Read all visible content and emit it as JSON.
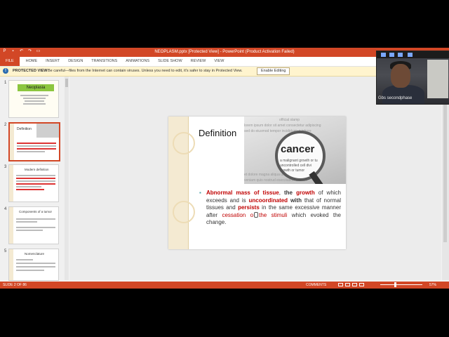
{
  "window": {
    "title": "NEOPLASM.pptx [Protected View] - PowerPoint (Product Activation Failed)"
  },
  "ribbon": {
    "tabs": [
      "FILE",
      "HOME",
      "INSERT",
      "DESIGN",
      "TRANSITIONS",
      "ANIMATIONS",
      "SLIDE SHOW",
      "REVIEW",
      "VIEW"
    ]
  },
  "message_bar": {
    "label": "PROTECTED VIEW",
    "text": "Be careful—files from the Internet can contain viruses. Unless you need to edit, it's safer to stay in Protected View.",
    "button": "Enable Editing"
  },
  "thumbnails": [
    {
      "num": "1",
      "title": "Neoplasia"
    },
    {
      "num": "2",
      "title": "Definition"
    },
    {
      "num": "3",
      "title": "Modern definition"
    },
    {
      "num": "4",
      "title": "Components of a tumor"
    },
    {
      "num": "5",
      "title": "Nomenclature"
    }
  ],
  "slide": {
    "title": "Definition",
    "image_words": {
      "main": "cancer",
      "line1": "a malignant growth or tu",
      "line2": "uncontrolled cell divi",
      "line3": "growth or tumor",
      "top": "official stamp"
    },
    "bullet": {
      "p1": "Abnormal mass of tissue",
      "p2": ", ",
      "p3": "the",
      "p4": " ",
      "p5": "growth",
      "p6": " of which exceeds and is ",
      "p7": "uncoordinated",
      "p8": " ",
      "p9": "with",
      "p10": " that of normal tissues and ",
      "p11": "persists",
      "p12": " in the same excessive manner after ",
      "p13": "cessation o",
      "p14": "the stimuli",
      "p15": " which evoked the change."
    }
  },
  "status": {
    "slide_counter": "SLIDE 2 OF 86",
    "comments": "COMMENTS",
    "zoom": "57%"
  },
  "webcam": {
    "name": "Gbs secondphase"
  },
  "colors": {
    "accent": "#d24726",
    "slide_red": "#c00000",
    "bullet_teal": "#4ba3a8"
  }
}
